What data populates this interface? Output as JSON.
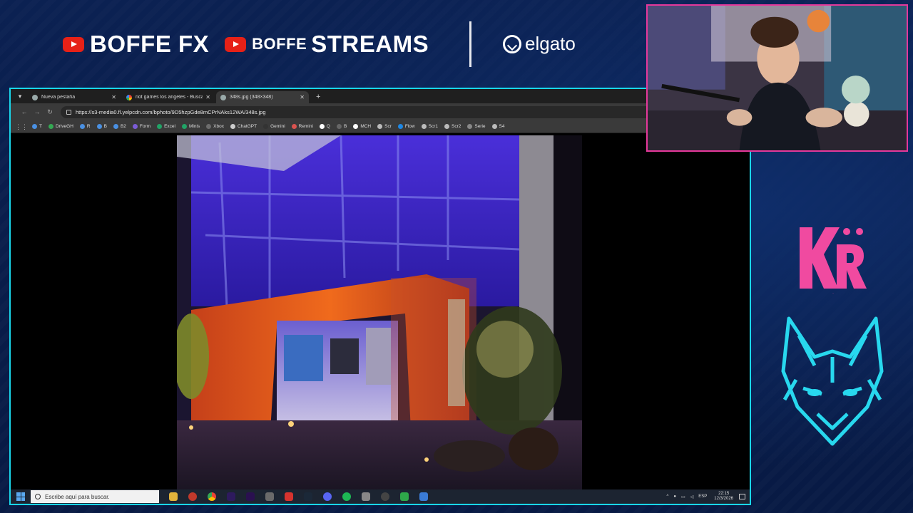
{
  "overlay": {
    "sponsor_1": "BOFFE FX",
    "sponsor_2_prefix": "BOFFE",
    "sponsor_2_main": "STREAMS",
    "sponsor_3": "elgato",
    "team_logo_text": "KRÜ",
    "colors": {
      "frame_accent": "#19d7ea",
      "webcam_border": "#e5389b",
      "kru_pink": "#f04aa0",
      "fox_cyan": "#28d8ee",
      "youtube_red": "#e62117"
    }
  },
  "browser": {
    "tabs": [
      {
        "label": "Nueva pestaña",
        "icon": "chrome-icon"
      },
      {
        "label": "riot games los angeles - Buscar",
        "icon": "google-icon"
      },
      {
        "label": "348s.jpg (348×348)",
        "icon": "image-icon",
        "active": true
      }
    ],
    "url": "https://s3-media0.fl.yelpcdn.com/bphoto/9D5hzpGde8mCPrNAks12WA/348s.jpg",
    "bookmarks": [
      {
        "label": "T",
        "color": "#4a90e2"
      },
      {
        "label": "DriveGH",
        "color": "#34a853"
      },
      {
        "label": "R",
        "color": "#4a90e2"
      },
      {
        "label": "B",
        "color": "#4a90e2"
      },
      {
        "label": "B2",
        "color": "#4a90e2"
      },
      {
        "label": "Form",
        "color": "#7b5cd6"
      },
      {
        "label": "Excel",
        "color": "#21a366"
      },
      {
        "label": "Minis",
        "color": "#21a366"
      },
      {
        "label": "Xbox",
        "color": "#6c6c6c"
      },
      {
        "label": "ChatGPT",
        "color": "#cccccc"
      },
      {
        "label": "Gemini",
        "color": "#333333"
      },
      {
        "label": "Remini",
        "color": "#d9534f"
      },
      {
        "label": "Q",
        "color": "#ffffff"
      },
      {
        "label": "B",
        "color": "#666666"
      },
      {
        "label": "MCH",
        "color": "#ffffff"
      },
      {
        "label": "Scr",
        "color": "#bbbbbb"
      },
      {
        "label": "Flow",
        "color": "#1e88e5"
      },
      {
        "label": "Scr1",
        "color": "#bbbbbb"
      },
      {
        "label": "Scr2",
        "color": "#bbbbbb"
      },
      {
        "label": "Serie",
        "color": "#888888"
      },
      {
        "label": "S4",
        "color": "#bbbbbb"
      }
    ]
  },
  "taskbar": {
    "search_placeholder": "Escribe aquí para buscar.",
    "language": "ESP",
    "time": "22:15",
    "date": "12/3/2026"
  }
}
